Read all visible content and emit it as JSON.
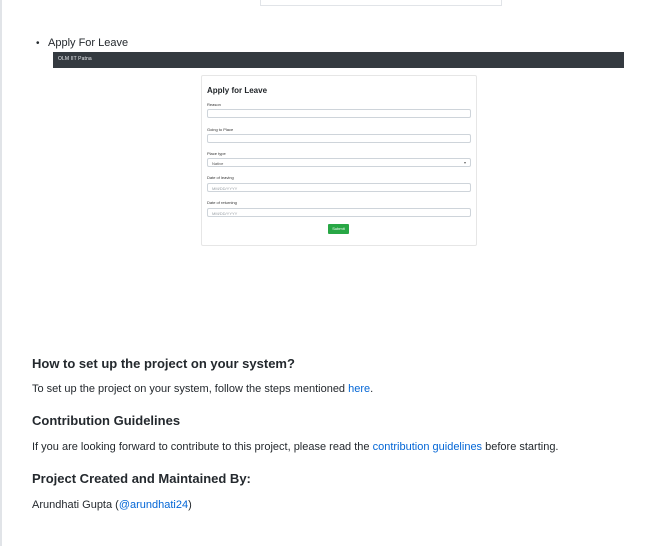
{
  "list": {
    "item_label": "Apply For Leave"
  },
  "screenshot": {
    "brand": "OLM IIT Patna",
    "form_title": "Apply for Leave",
    "fields": {
      "reason_label": "Reason",
      "place_label": "Going to Place",
      "place_type_label": "Place type",
      "place_type_value": "Native",
      "leaving_label": "Date of leaving",
      "leaving_placeholder": "MM/DD/YYYY",
      "returning_label": "Date of returning",
      "returning_placeholder": "MM/DD/YYYY"
    },
    "submit_label": "Submit"
  },
  "sections": {
    "setup": {
      "heading": "How to set up the project on your system?",
      "text_before": "To set up the project on your system, follow the steps mentioned ",
      "link": "here",
      "text_after": "."
    },
    "contribution": {
      "heading": "Contribution Guidelines",
      "text_before": "If you are looking forward to contribute to this project, please read the ",
      "link": "contribution guidelines",
      "text_after": " before starting."
    },
    "maintainer": {
      "heading": "Project Created and Maintained By:",
      "name": "Arundhati Gupta (",
      "link": "@arundhati24",
      "text_after": ")"
    }
  },
  "colors": {
    "link": "#0366d6",
    "navbar": "#343a40",
    "submit": "#28a745"
  }
}
